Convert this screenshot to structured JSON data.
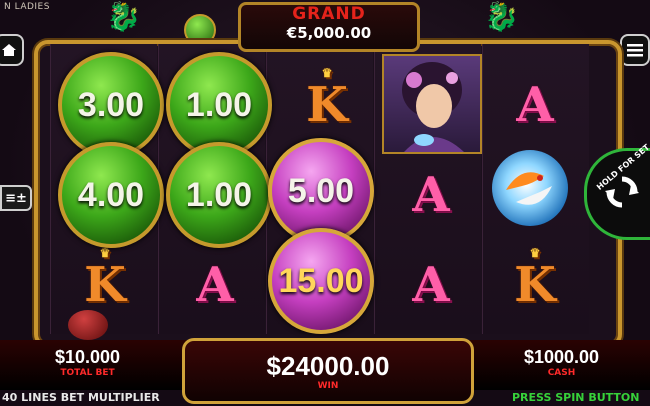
{
  "game": {
    "title_fragment": "N LADIES"
  },
  "jackpot": {
    "label": "GRAND",
    "value": "€5,000.00"
  },
  "orbs": [
    {
      "value": "3.00",
      "color": "green"
    },
    {
      "value": "1.00",
      "color": "green"
    },
    {
      "value": "4.00",
      "color": "green"
    },
    {
      "value": "1.00",
      "color": "green"
    },
    {
      "value": "5.00",
      "color": "purple"
    },
    {
      "value": "15.00",
      "color": "purple"
    }
  ],
  "symbols": {
    "k": "K",
    "a": "A"
  },
  "hold_button": {
    "label": "HOLD FOR SET"
  },
  "bet": {
    "value": "$10.000",
    "label": "TOTAL BET"
  },
  "win": {
    "value": "$24000.00",
    "label": "WIN"
  },
  "cash": {
    "value": "$1000.00",
    "label": "CASH"
  },
  "footer": {
    "left": "40 LINES BET MULTIPLIER",
    "right": "PRESS SPIN BUTTON"
  },
  "left_bet_button": "≡±",
  "icons": {
    "home": "home-icon",
    "menu": "menu-icon",
    "spin": "refresh-icon"
  },
  "colors": {
    "frame_gold": "#c9962e",
    "green_accent": "#37d13a",
    "red_label": "#ff2a2a"
  }
}
